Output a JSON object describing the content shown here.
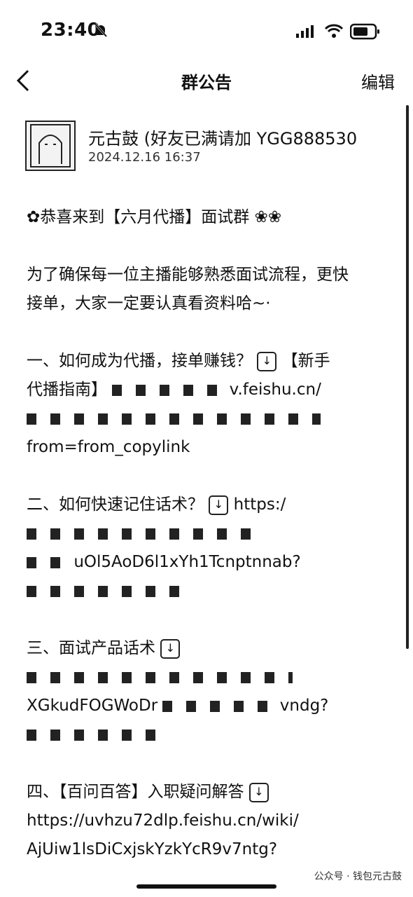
{
  "status": {
    "time": "23:40"
  },
  "nav": {
    "title": "群公告",
    "edit": "编辑"
  },
  "author": {
    "name": "元古鼓 (好友已满请加 YGG888530",
    "datetime": "2024.12.16  16:37"
  },
  "post": {
    "greeting": "恭喜来到【六月代播】面试群",
    "intro_line1": "为了确保每一位主播能够熟悉面试流程，更快",
    "intro_line2": "接单，大家一定要认真看资料哈~·",
    "s1_line1": "一、如何成为代播，接单赚钱？",
    "s1_tag": "【新手",
    "s1_line2": "代播指南】",
    "s1_line2_tail": "v.feishu.cn/",
    "s1_line4": "from=from_copylink",
    "s2_line1": "二、如何快速记住话术？",
    "s2_line1_tail": "https:/",
    "s2_line3": "uOl5AoD6l1xYh1Tcnptnnab?",
    "s3_line1": "三、面试产品话术",
    "s3_line3": "XGkudFOGWoDr",
    "s3_line3_tail": "vndg?",
    "s4_line1": "四、【百问百答】入职疑问解答",
    "s4_line2": "https://uvhzu72dlp.feishu.cn/wiki/",
    "s4_line3": "AjUiw1lsDiCxjskYzkYcR9v7ntg?"
  },
  "watermark": "公众号 · 钱包元古鼓",
  "icons": [
    "back-icon",
    "bell-mute-icon",
    "signal-icon",
    "wifi-icon",
    "battery-icon",
    "pointing-hand-icon",
    "down-arrow-box-icon",
    "flower-icon"
  ]
}
